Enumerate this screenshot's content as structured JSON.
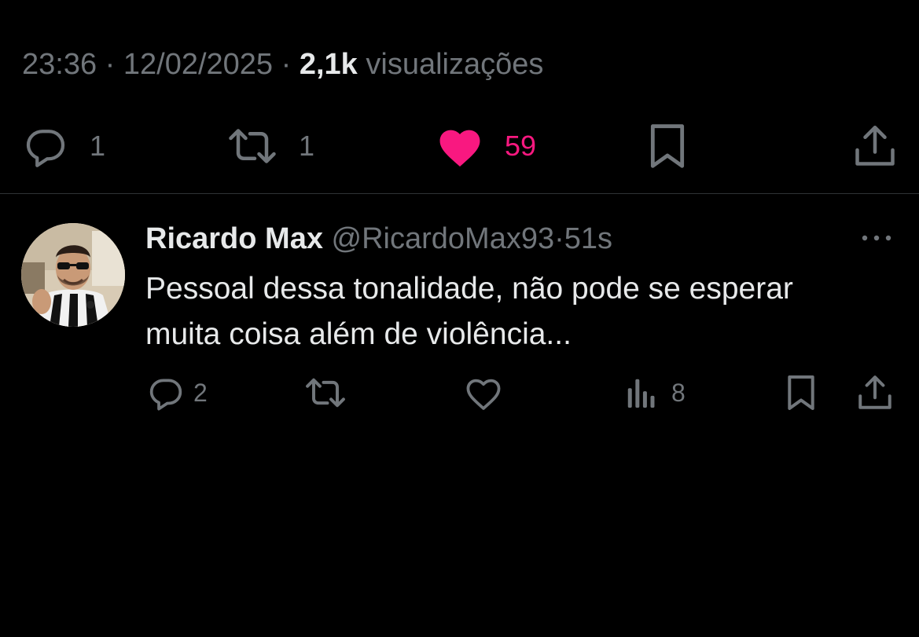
{
  "tweet": {
    "time": "23:36",
    "separator": " · ",
    "date": "12/02/2025",
    "views_count": "2,1k",
    "views_label": "visualizações",
    "actions": {
      "reply_count": "1",
      "retweet_count": "1",
      "like_count": "59"
    }
  },
  "reply": {
    "name": "Ricardo Max",
    "handle": "@RicardoMax93",
    "dot": "·",
    "time": "51s",
    "text_line1": "Pessoal dessa tonalidade,  não pode se esperar",
    "text_line2": "muita coisa além de violência...",
    "actions": {
      "reply_count": "2",
      "views_count": "8"
    }
  },
  "icons": {
    "reply": "reply-icon",
    "retweet": "retweet-icon",
    "like": "heart-icon",
    "bookmark": "bookmark-icon",
    "share": "share-icon",
    "views": "views-icon",
    "more": "more-icon"
  },
  "colors": {
    "background": "#000000",
    "text_primary": "#e7e9ea",
    "text_secondary": "#71767b",
    "like_accent": "#f91880",
    "divider": "#2f3336"
  }
}
